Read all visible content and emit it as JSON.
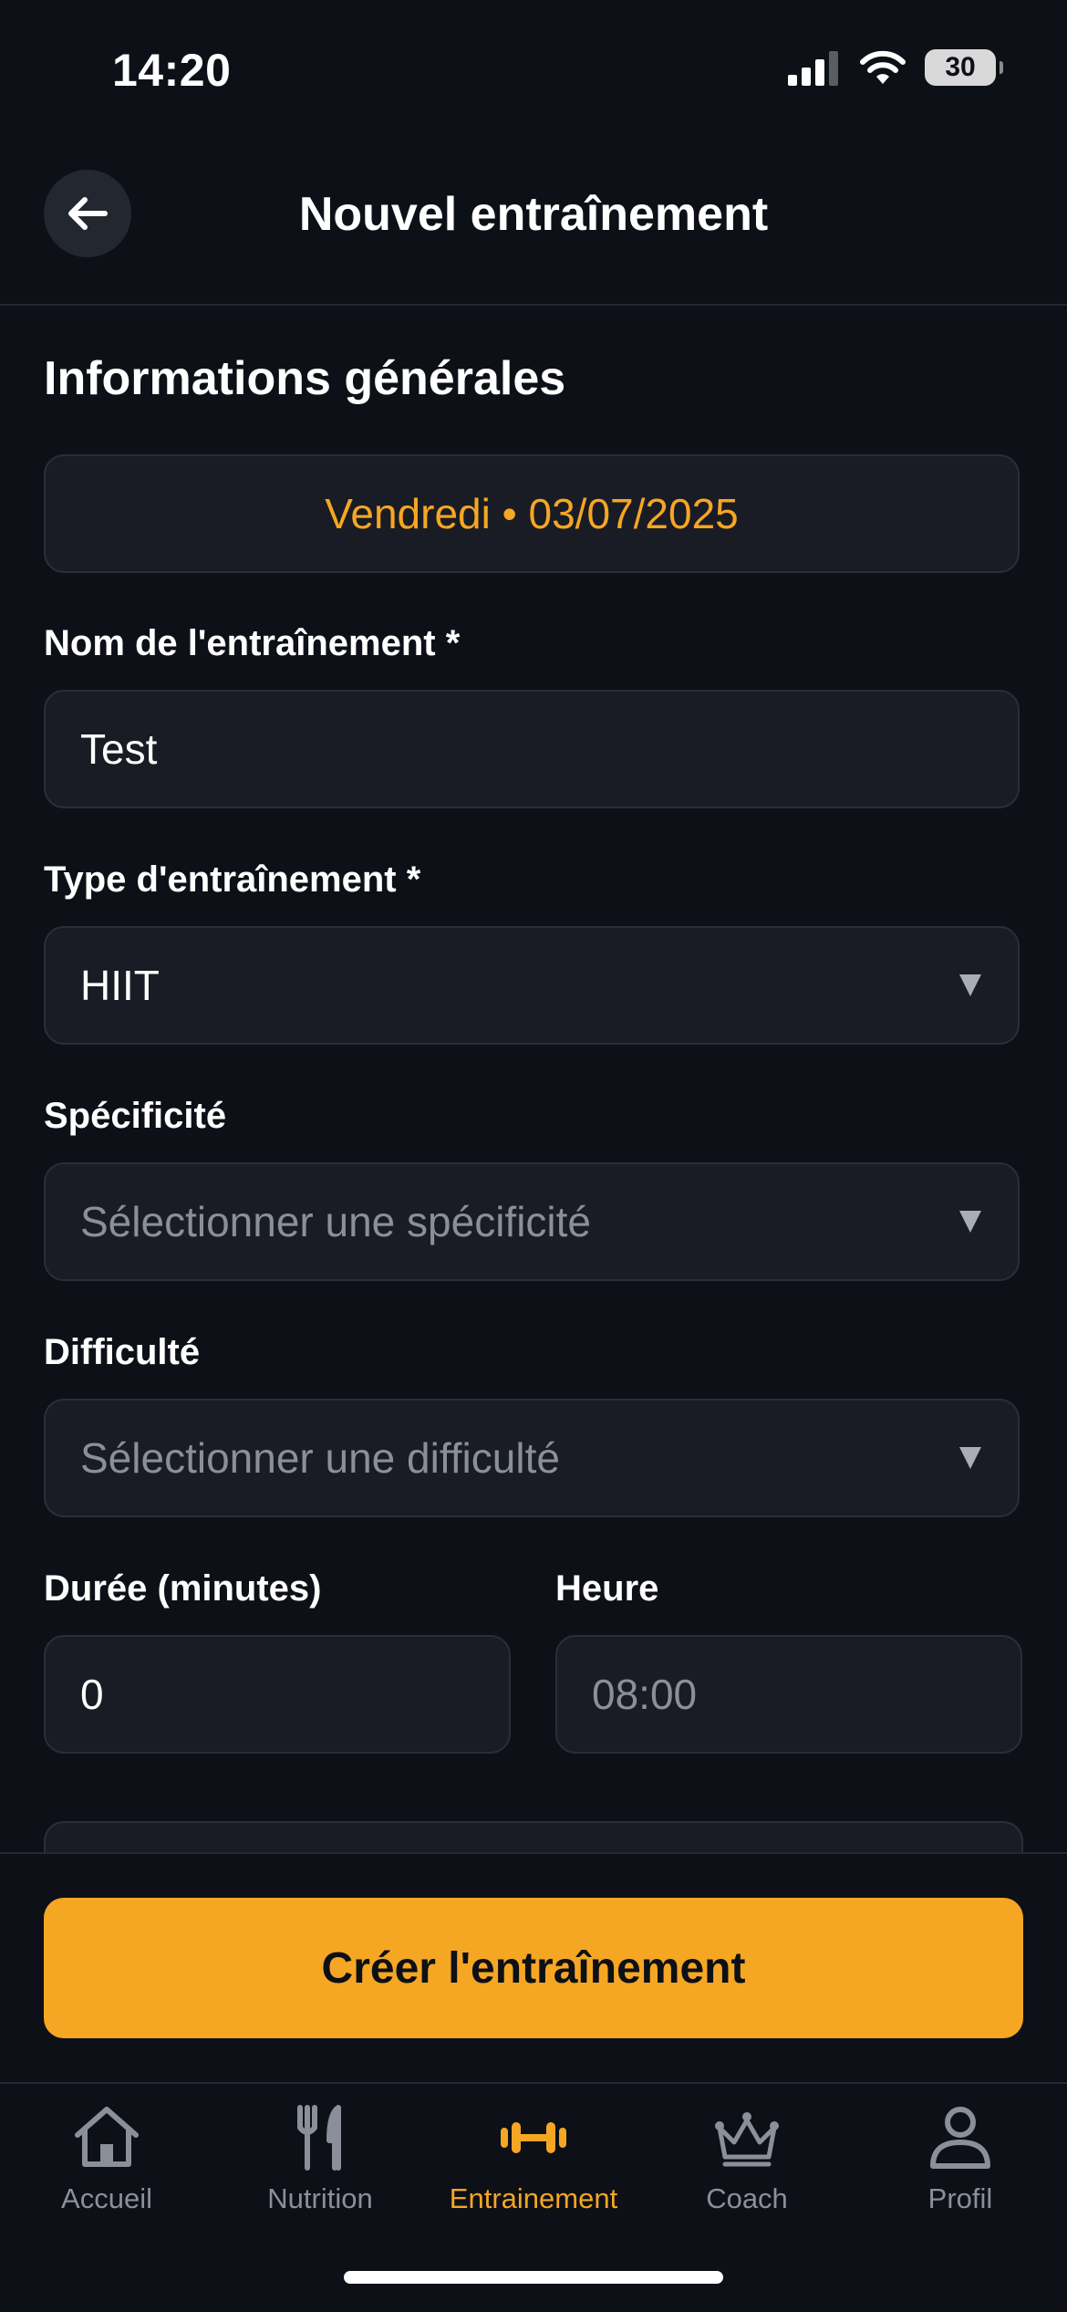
{
  "status_bar": {
    "time": "14:20",
    "battery": "30"
  },
  "header": {
    "title": "Nouvel entraînement"
  },
  "form": {
    "section_title": "Informations générales",
    "date_display": "Vendredi • 03/07/2025",
    "name": {
      "label": "Nom de l'entraînement *",
      "value": "Test"
    },
    "type": {
      "label": "Type d'entraînement *",
      "value": "HIIT"
    },
    "specificity": {
      "label": "Spécificité",
      "placeholder": "Sélectionner une spécificité"
    },
    "difficulty": {
      "label": "Difficulté",
      "placeholder": "Sélectionner une difficulté"
    },
    "duration": {
      "label": "Durée (minutes)",
      "value": "0"
    },
    "time": {
      "label": "Heure",
      "placeholder": "08:00"
    }
  },
  "actions": {
    "create_label": "Créer l'entraînement"
  },
  "tab_bar": {
    "items": [
      {
        "label": "Accueil",
        "icon": "home-icon"
      },
      {
        "label": "Nutrition",
        "icon": "fork-knife-icon"
      },
      {
        "label": "Entrainement",
        "icon": "dumbbell-icon",
        "active": true
      },
      {
        "label": "Coach",
        "icon": "crown-icon"
      },
      {
        "label": "Profil",
        "icon": "user-icon"
      }
    ]
  },
  "colors": {
    "background": "#0d1016",
    "surface": "#191c24",
    "accent": "#f5a623",
    "muted": "#8a8f99"
  }
}
